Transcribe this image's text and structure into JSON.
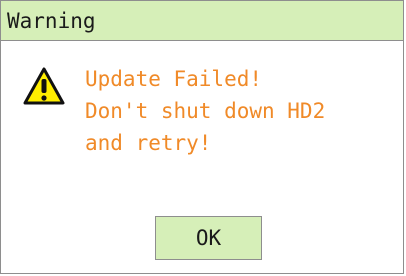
{
  "dialog": {
    "title": "Warning",
    "icon": "warning-icon",
    "message_lines": [
      "Update Failed!",
      "Don't shut down HD2",
      "and retry!"
    ],
    "ok_label": "OK"
  },
  "colors": {
    "title_bar": "#d6efb8",
    "button": "#d6efb8",
    "message_text": "#f08a28",
    "border": "#8e8e8e",
    "icon_fill": "#ffee00"
  }
}
